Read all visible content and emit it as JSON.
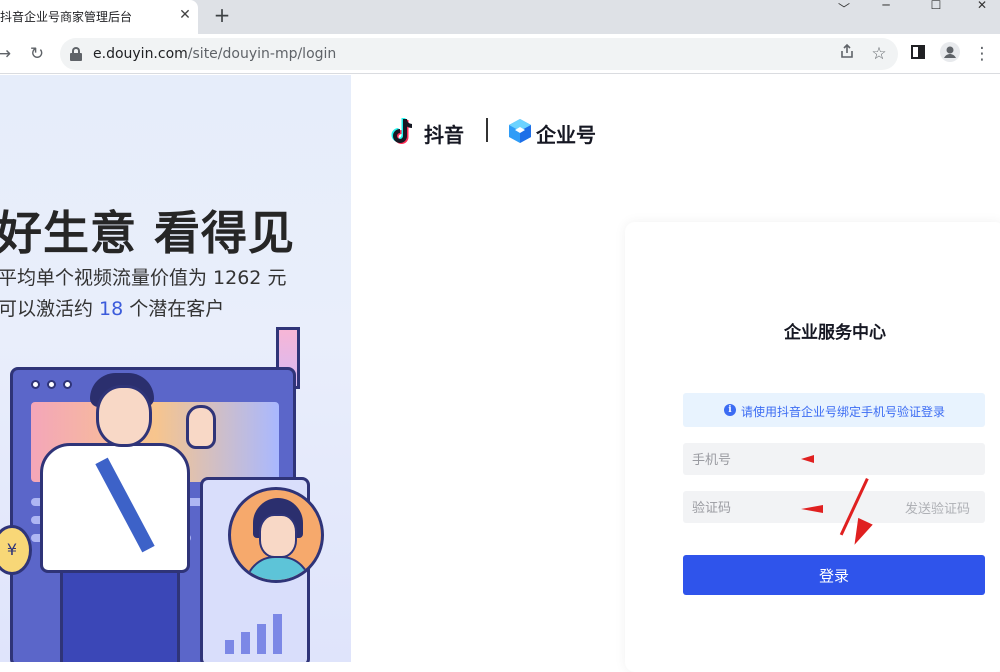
{
  "browser": {
    "tab_title": "抖音企业号商家管理后台",
    "close_tab": "✕",
    "new_tab": "+",
    "url_domain": "e.douyin.com",
    "url_path": "/site/douyin-mp/login",
    "window_controls": [
      "﹀",
      "─",
      "☐",
      "✕"
    ]
  },
  "hero": {
    "slogan": "好生意 看得见",
    "line1_prefix": "平均单个视频流量价值为 ",
    "line1_number": "1262",
    "line1_suffix": " 元",
    "line2_prefix": "可以激活约 ",
    "line2_number": "18",
    "line2_suffix": " 个潜在客户",
    "coin_symbol": "¥"
  },
  "brand": {
    "douyin": "抖音",
    "qiye": "企业号"
  },
  "login": {
    "title": "企业服务中心",
    "notice_icon": "i",
    "notice": "请使用抖音企业号绑定手机号验证登录",
    "phone_placeholder": "手机号",
    "code_placeholder": "验证码",
    "send_code": "发送验证码",
    "submit": "登录"
  },
  "colors": {
    "primary": "#2f54eb",
    "notice_bg": "#e8f3fe",
    "annotation_red": "#e02020"
  }
}
